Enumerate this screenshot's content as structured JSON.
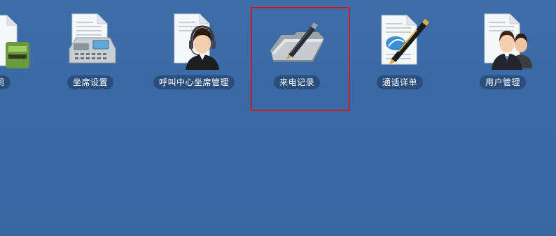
{
  "desktop": {
    "items": [
      {
        "label": "间",
        "icon": "partial-document-icon"
      },
      {
        "label": "坐席设置",
        "icon": "desk-phone-document-icon"
      },
      {
        "label": "呼叫中心坐席管理",
        "icon": "headset-agent-document-icon"
      },
      {
        "label": "来电记录",
        "icon": "folder-pen-icon"
      },
      {
        "label": "通话详单",
        "icon": "pen-document-icon"
      },
      {
        "label": "用户管理",
        "icon": "users-document-icon"
      }
    ],
    "selected_index": 3
  },
  "colors": {
    "background": "#3a6aa4",
    "label_pill": "#2b4f7c",
    "highlight": "#d11a1a"
  }
}
